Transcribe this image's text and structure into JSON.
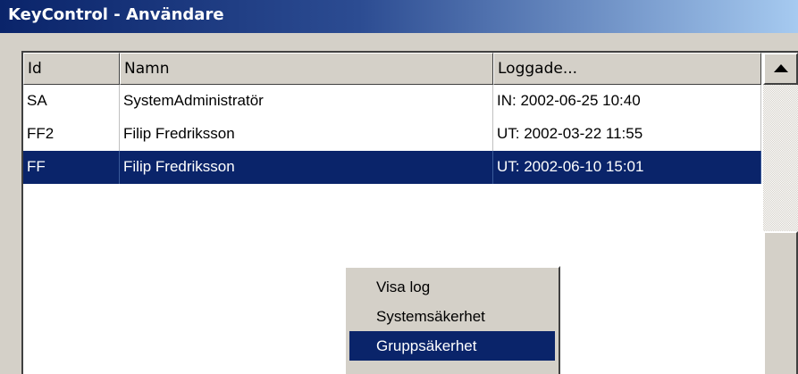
{
  "window": {
    "title": "KeyControl - Användare"
  },
  "list": {
    "columns": [
      "Id",
      "Namn",
      "Loggade..."
    ],
    "rows": [
      {
        "id": "SA",
        "namn": "SystemAdministratör",
        "loggade": "IN: 2002-06-25 10:40",
        "selected": false
      },
      {
        "id": "FF2",
        "namn": "Filip Fredriksson",
        "loggade": "UT: 2002-03-22 11:55",
        "selected": false
      },
      {
        "id": "FF",
        "namn": "Filip Fredriksson",
        "loggade": "UT: 2002-06-10 15:01",
        "selected": true
      }
    ]
  },
  "context_menu": {
    "items": [
      {
        "label": "Visa log",
        "highlighted": false
      },
      {
        "label": "Systemsäkerhet",
        "highlighted": false
      },
      {
        "label": "Gruppsäkerhet",
        "highlighted": true
      }
    ]
  },
  "colors": {
    "selection": "#0a246a",
    "face": "#d4d0c8",
    "title_start": "#0a246a",
    "title_end": "#a6caf0"
  },
  "icons": {
    "scroll_up": "triangle-up-icon"
  }
}
